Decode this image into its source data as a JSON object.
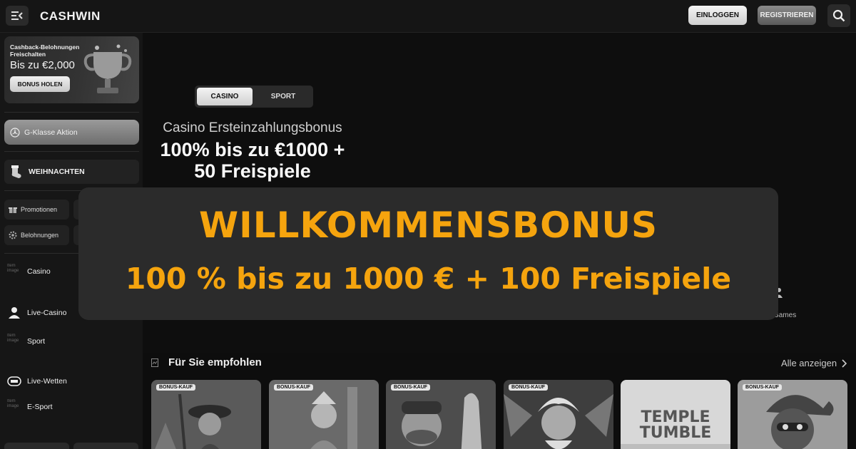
{
  "header": {
    "logo": "CASHWIN",
    "login_label": "EINLOGGEN",
    "register_label": "REGISTRIEREN"
  },
  "sidebar": {
    "cashback": {
      "title": "Cashback-Belohnungen Freischalten",
      "amount": "Bis zu €2,000",
      "button": "BONUS HOLEN"
    },
    "promo_gklasse": "G-Klasse Aktion",
    "weihnachten": "WEIHNACHTEN",
    "quick_links": [
      "Promotionen",
      "Belohnungen"
    ],
    "nav": [
      {
        "label": "Casino",
        "broken_alt": "Item image"
      },
      {
        "label": "Live-Casino"
      },
      {
        "label": "Sport",
        "broken_alt": "Item image"
      },
      {
        "label": "Live-Wetten"
      },
      {
        "label": "E-Sport",
        "broken_alt": "Item image"
      }
    ]
  },
  "hero": {
    "tabs": [
      "CASINO",
      "SPORT"
    ],
    "active_tab": "CASINO",
    "subtitle": "Casino Ersteinzahlungsbonus",
    "headline_1": "100% bis zu €1000 +",
    "headline_2": "50 Freispiele",
    "games_label": "Games"
  },
  "overlay": {
    "title": "WILLKOMMENSBONUS",
    "subtitle": "100 % bis zu 1000 € + 100 Freispiele",
    "color": "#f5a40e"
  },
  "recommended": {
    "title": "Für Sie empfohlen",
    "view_all": "Alle anzeigen",
    "games": [
      {
        "badge": "BONUS-KAUF"
      },
      {
        "badge": "BONUS-KAUF"
      },
      {
        "badge": "BONUS-KAUF"
      },
      {
        "badge": "BONUS-KAUF"
      },
      {
        "title_art": "TEMPLE TUMBLE"
      },
      {
        "badge": "BONUS-KAUF"
      }
    ]
  }
}
